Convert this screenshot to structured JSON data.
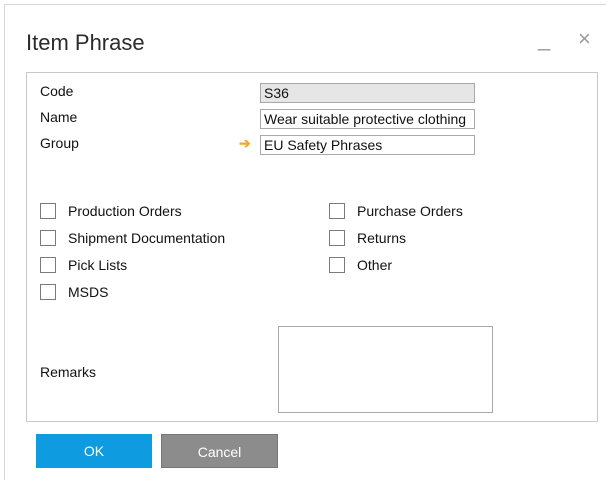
{
  "window": {
    "title": "Item Phrase",
    "minimize_glyph": "_",
    "close_glyph": "×"
  },
  "form": {
    "code_label": "Code",
    "code_value": "S36",
    "name_label": "Name",
    "name_value": "Wear suitable protective clothing",
    "group_label": "Group",
    "group_value": "EU Safety Phrases",
    "group_link_icon": "orange-arrow-icon",
    "group_arrow_glyph": "➔"
  },
  "checkboxes": {
    "production_orders": {
      "label": "Production Orders",
      "checked": false
    },
    "shipment_documentation": {
      "label": "Shipment Documentation",
      "checked": false
    },
    "pick_lists": {
      "label": "Pick Lists",
      "checked": false
    },
    "msds": {
      "label": "MSDS",
      "checked": false
    },
    "purchase_orders": {
      "label": "Purchase Orders",
      "checked": false
    },
    "returns": {
      "label": "Returns",
      "checked": false
    },
    "other": {
      "label": "Other",
      "checked": false
    }
  },
  "remarks": {
    "label": "Remarks",
    "value": ""
  },
  "buttons": {
    "ok": "OK",
    "cancel": "Cancel"
  },
  "colors": {
    "ok_button": "#0f9be0",
    "cancel_button": "#8c8c8c",
    "arrow": "#f2a92c",
    "readonly_field": "#e6e6e6"
  }
}
